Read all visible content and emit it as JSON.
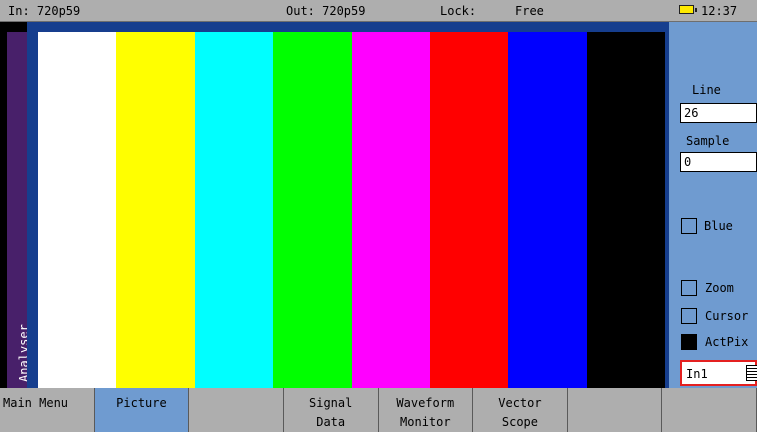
{
  "status_bar": {
    "input_format": "In: 720p59",
    "output_format": "Out: 720p59",
    "lock_label": "Lock:",
    "lock_value": "Free",
    "battery_icon": "battery-icon",
    "battery_color": "#ffea00",
    "time": "12:37"
  },
  "side_tab": {
    "label": "Analyser",
    "color": "#48206a"
  },
  "picture": {
    "background": "#163e8e",
    "color_bars": [
      "#ffffff",
      "#ffff00",
      "#00ffff",
      "#00ff00",
      "#ff00ff",
      "#ff0000",
      "#0000ff",
      "#000000"
    ]
  },
  "panel": {
    "background": "#6f9bd0",
    "line_label": "Line",
    "line_value": "26",
    "sample_label": "Sample",
    "sample_value": "0",
    "blue_label": "Blue",
    "blue_checked": false,
    "zoom_label": "Zoom",
    "zoom_checked": false,
    "cursor_label": "Cursor",
    "cursor_checked": false,
    "actpix_label": "ActPix",
    "actpix_checked": true,
    "source_value": "In1"
  },
  "menu": {
    "items": [
      {
        "l1": "Main Menu",
        "l2": "",
        "active": false
      },
      {
        "l1": "Picture",
        "l2": "",
        "active": true
      },
      {
        "l1": "",
        "l2": "",
        "active": false
      },
      {
        "l1": "Signal",
        "l2": "Data",
        "active": false
      },
      {
        "l1": "Waveform",
        "l2": "Monitor",
        "active": false
      },
      {
        "l1": "Vector",
        "l2": "Scope",
        "active": false
      },
      {
        "l1": "",
        "l2": "",
        "active": false
      },
      {
        "l1": "",
        "l2": "",
        "active": false
      }
    ]
  }
}
